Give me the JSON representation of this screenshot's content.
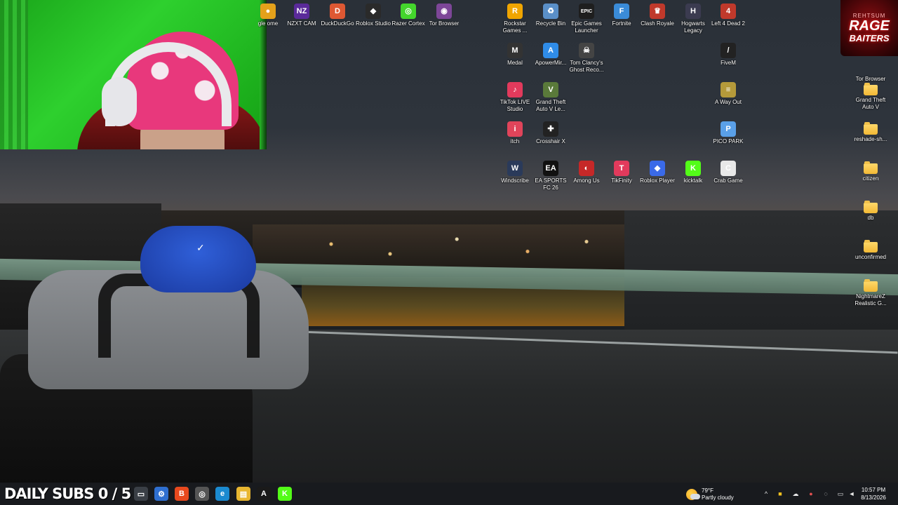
{
  "desktop": {
    "icons": [
      {
        "label": "gle ome",
        "glyph": "●",
        "color": "#e4a11b"
      },
      {
        "label": "NZXT CAM",
        "glyph": "NZ",
        "color": "#5a2a9a"
      },
      {
        "label": "DuckDuckGo",
        "glyph": "D",
        "color": "#de5833"
      },
      {
        "label": "Roblox Studio",
        "glyph": "◆",
        "color": "#2a2a2a"
      },
      {
        "label": "Razer Cortex",
        "glyph": "◎",
        "color": "#44d62c"
      },
      {
        "label": "Tor Browser",
        "glyph": "◉",
        "color": "#7d4698"
      },
      {
        "label": "Rockstar Games ...",
        "glyph": "R",
        "color": "#f0a500"
      },
      {
        "label": "Recycle Bin",
        "glyph": "♻",
        "color": "#5a8fc8"
      },
      {
        "label": "Epic Games Launcher",
        "glyph": "EPIC",
        "color": "#1e1e1e"
      },
      {
        "label": "Fortnite",
        "glyph": "F",
        "color": "#3a8bd8"
      },
      {
        "label": "Clash Royale",
        "glyph": "♛",
        "color": "#c0392b"
      },
      {
        "label": "Hogwarts Legacy",
        "glyph": "H",
        "color": "#3b3b50"
      },
      {
        "label": "Left 4 Dead 2",
        "glyph": "4",
        "color": "#c0392b"
      },
      {
        "label": "Medal",
        "glyph": "M",
        "color": "#333"
      },
      {
        "label": "ApowerMir...",
        "glyph": "A",
        "color": "#2f8ce8"
      },
      {
        "label": "Tom Clancy's Ghost Reco...",
        "glyph": "☠",
        "color": "#444"
      },
      {
        "label": "FiveM",
        "glyph": "/",
        "color": "#222"
      },
      {
        "label": "TikTok LIVE Studio",
        "glyph": "♪",
        "color": "#e23a5c"
      },
      {
        "label": "Grand Theft Auto V Le...",
        "glyph": "V",
        "color": "#5a7a3a"
      },
      {
        "label": "A Way Out",
        "glyph": "≡",
        "color": "#b59a3a"
      },
      {
        "label": "itch",
        "glyph": "i",
        "color": "#e0445a"
      },
      {
        "label": "Crosshair X",
        "glyph": "✚",
        "color": "#222"
      },
      {
        "label": "PICO PARK",
        "glyph": "P",
        "color": "#5aa0e8"
      },
      {
        "label": "Windscribe",
        "glyph": "W",
        "color": "#2a3a5a"
      },
      {
        "label": "EA SPORTS FC 26",
        "glyph": "EA",
        "color": "#111"
      },
      {
        "label": "Among Us",
        "glyph": "◐",
        "color": "#c62828"
      },
      {
        "label": "TikFinity",
        "glyph": "T",
        "color": "#e23a5c"
      },
      {
        "label": "Roblox Player",
        "glyph": "◆",
        "color": "#3a6ae8"
      },
      {
        "label": "kicktalk",
        "glyph": "K",
        "color": "#53fc18"
      },
      {
        "label": "Crab Game",
        "glyph": "C",
        "color": "#e8e8e8"
      },
      {
        "label": "Tor Browser",
        "glyph": "",
        "color": "#7d4698"
      },
      {
        "label": "Grand Theft Auto V",
        "glyph": "",
        "color": "#f2b935"
      },
      {
        "label": "reshade-sh...",
        "glyph": "",
        "color": "#f2b935"
      },
      {
        "label": "citizen",
        "glyph": "",
        "color": "#f2b935"
      },
      {
        "label": "db",
        "glyph": "",
        "color": "#f2b935"
      },
      {
        "label": "unconfirmed",
        "glyph": "",
        "color": "#f2b935"
      },
      {
        "label": "NightmareZ Realistic G...",
        "glyph": "",
        "color": "#f2b935"
      }
    ],
    "logo": {
      "line1": "REHTSUM",
      "line2": "RAGE",
      "line3": "BAITERS"
    }
  },
  "overlay": {
    "daily_subs": "DAILY SUBS 0 / 5"
  },
  "taskbar": {
    "apps": [
      {
        "name": "start-menu-icon",
        "glyph": "⊞",
        "color": "#3a3f46"
      },
      {
        "name": "task-view-icon",
        "glyph": "▭",
        "color": "#3a3f46"
      },
      {
        "name": "settings-app-icon",
        "glyph": "⚙",
        "color": "#2f6fd0"
      },
      {
        "name": "brave-browser-icon",
        "glyph": "B",
        "color": "#e8491e"
      },
      {
        "name": "chrome-browser-icon",
        "glyph": "◎",
        "color": "#555"
      },
      {
        "name": "edge-browser-icon",
        "glyph": "e",
        "color": "#1b8ad0"
      },
      {
        "name": "file-explorer-icon",
        "glyph": "▤",
        "color": "#e8b630"
      },
      {
        "name": "nvidia-app-icon",
        "glyph": "A",
        "color": "#1a1a1a"
      },
      {
        "name": "kick-app-icon",
        "glyph": "K",
        "color": "#53fc18"
      }
    ],
    "weather": {
      "temp": "79°F",
      "condition": "Partly cloudy"
    },
    "clock": {
      "time": "10:57 PM",
      "date": "8/13/2026"
    }
  }
}
